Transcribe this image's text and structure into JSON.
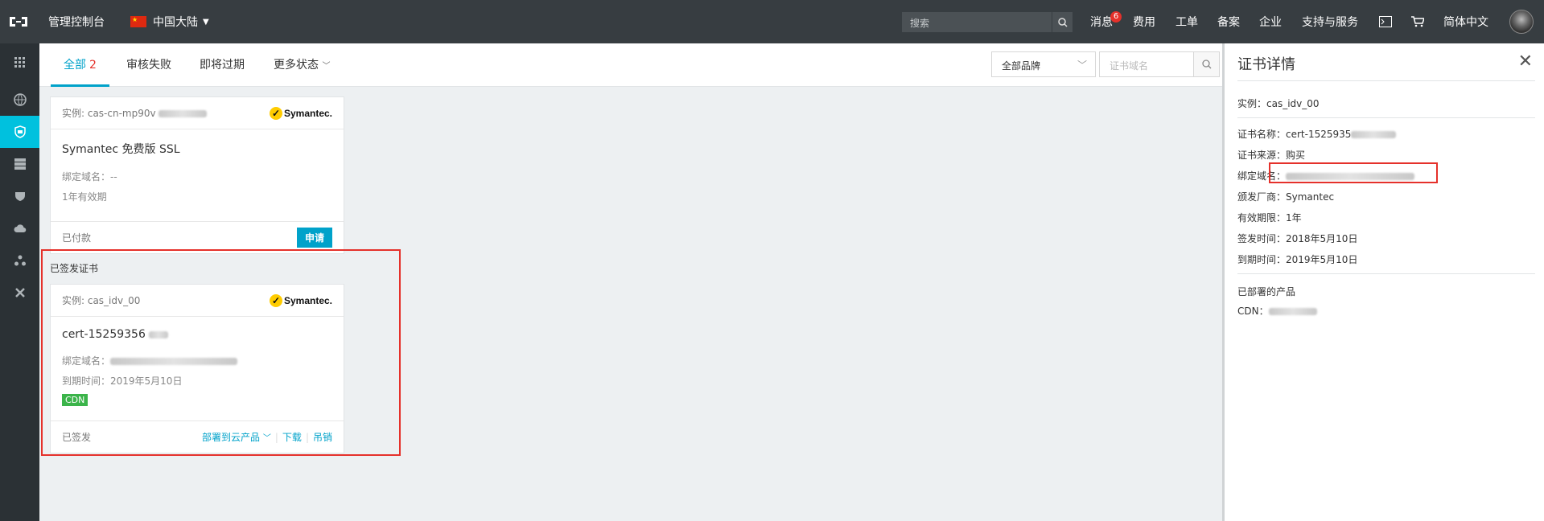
{
  "topbar": {
    "console": "管理控制台",
    "region": "中国大陆",
    "search_placeholder": "搜索",
    "nav": [
      {
        "label": "消息",
        "badge": "6"
      },
      {
        "label": "费用"
      },
      {
        "label": "工单"
      },
      {
        "label": "备案"
      },
      {
        "label": "企业"
      },
      {
        "label": "支持与服务"
      },
      {
        "label": "简体中文"
      }
    ]
  },
  "sidebar": {
    "icons": [
      "apps-grid-icon",
      "globe-icon",
      "shield-certificate-icon",
      "database-icon",
      "security-icon",
      "cloud-icon",
      "network-icon",
      "tools-icon"
    ],
    "active_index": 2
  },
  "tabs": [
    {
      "label": "全部",
      "count": "2",
      "active": true
    },
    {
      "label": "审核失败"
    },
    {
      "label": "即将过期"
    },
    {
      "label": "更多状态"
    }
  ],
  "filters": {
    "brand_select": "全部品牌",
    "cert_search_placeholder": "证书域名"
  },
  "cards": [
    {
      "instance": "实例: cas-cn-mp90v",
      "brand": "Symantec.",
      "title": "Symantec 免费版 SSL",
      "bind_domain": "绑定域名：--",
      "validity": "1年有效期",
      "status": "已付款",
      "action": "申请"
    },
    {
      "group_label": "已签发证书",
      "instance": "实例: cas_idv_00",
      "brand": "Symantec.",
      "title": "cert-15259356",
      "bind_domain_label": "绑定域名：",
      "expire": "到期时间：2019年5月10日",
      "tag": "CDN",
      "status": "已签发",
      "actions": [
        "部署到云产品",
        "下载",
        "吊销"
      ]
    }
  ],
  "panel": {
    "title": "证书详情",
    "instance": "实例：cas_idv_00",
    "name": "证书名称：cert-1525935",
    "source": "证书来源：购买",
    "bind_domain": "绑定域名：",
    "issuer": "颁发厂商：Symantec",
    "validity": "有效期限：1年",
    "issue_time": "签发时间：2018年5月10日",
    "expire_time": "到期时间：2019年5月10日",
    "deployed_label": "已部署的产品",
    "cdn": "CDN："
  },
  "colors": {
    "topbar": "#373d41",
    "accent": "#00a2ca",
    "highlight": "#e5312b",
    "cdn_tag": "#3bb44a"
  }
}
